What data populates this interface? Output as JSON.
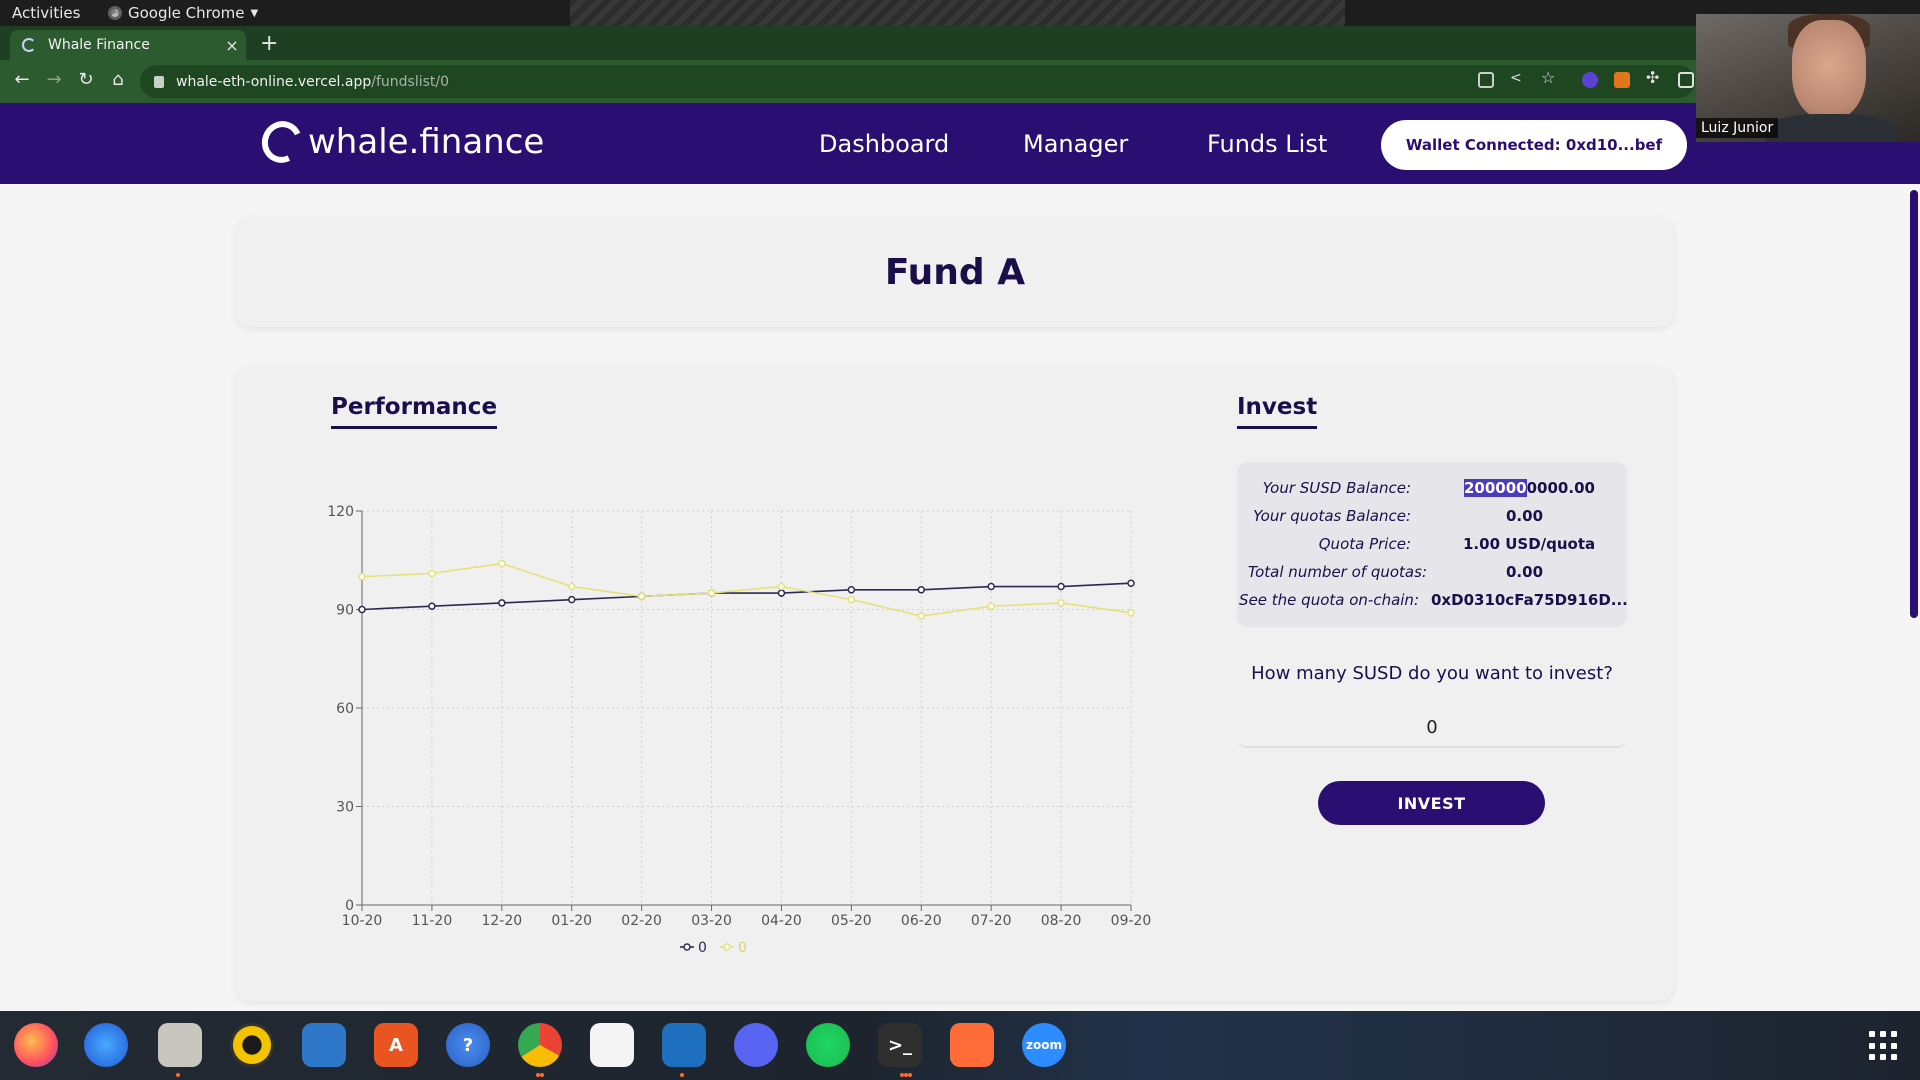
{
  "system_bar": {
    "activities": "Activities",
    "app_name": "Google Chrome"
  },
  "browser": {
    "tab_title": "Whale Finance",
    "tab_close": "×",
    "new_tab": "+",
    "url_host": "whale-eth-online.vercel.app",
    "url_path": "/fundslist/0"
  },
  "webcam": {
    "name": "Luiz Junior"
  },
  "site": {
    "brand": "whale.finance",
    "nav": [
      "Dashboard",
      "Manager",
      "Funds List"
    ],
    "wallet_button": "Wallet Connected: 0xd10...bef"
  },
  "fund": {
    "title": "Fund A"
  },
  "performance": {
    "heading": "Performance"
  },
  "invest": {
    "heading": "Invest",
    "rows": [
      {
        "label": "Your SUSD Balance:",
        "value": "2000000000.00"
      },
      {
        "label": "Your quotas Balance:",
        "value": "0.00"
      },
      {
        "label": "Quota Price:",
        "value": "1.00 USD/quota"
      },
      {
        "label": "Total number of quotas:",
        "value": "0.00"
      },
      {
        "label": "See the quota on-chain:",
        "value": "0xD0310cFa75D916D..."
      }
    ],
    "question": "How many SUSD do you want to invest?",
    "amount_value": "0",
    "button": "INVEST"
  },
  "colors": {
    "brand_purple": "#2a0e72",
    "series_dark": "#2c2a52",
    "series_yellow": "#e3e27a"
  },
  "dock": {
    "apps": [
      "firefox-icon",
      "thunderbird-icon",
      "files-icon",
      "rhythmbox-icon",
      "writer-icon",
      "software-icon",
      "help-icon",
      "chrome-icon",
      "slack-icon",
      "vscode-icon",
      "discord-icon",
      "spotify-icon",
      "terminal-icon",
      "postman-icon",
      "zoom-icon"
    ],
    "zoom_label": "zoom"
  },
  "chart_data": {
    "type": "line",
    "categories": [
      "10-20",
      "11-20",
      "12-20",
      "01-20",
      "02-20",
      "03-20",
      "04-20",
      "05-20",
      "06-20",
      "07-20",
      "08-20",
      "09-20"
    ],
    "yticks": [
      0,
      30,
      60,
      90,
      120
    ],
    "ylim": [
      0,
      120
    ],
    "series": [
      {
        "name": "0",
        "color": "#2c2a52",
        "values": [
          90,
          91,
          92,
          93,
          94,
          95,
          95,
          96,
          96,
          97,
          97,
          98
        ]
      },
      {
        "name": "0",
        "color": "#e3e27a",
        "values": [
          100,
          101,
          104,
          97,
          94,
          95,
          97,
          93,
          88,
          91,
          92,
          89
        ]
      }
    ],
    "grid": true,
    "legend_position": "bottom"
  }
}
